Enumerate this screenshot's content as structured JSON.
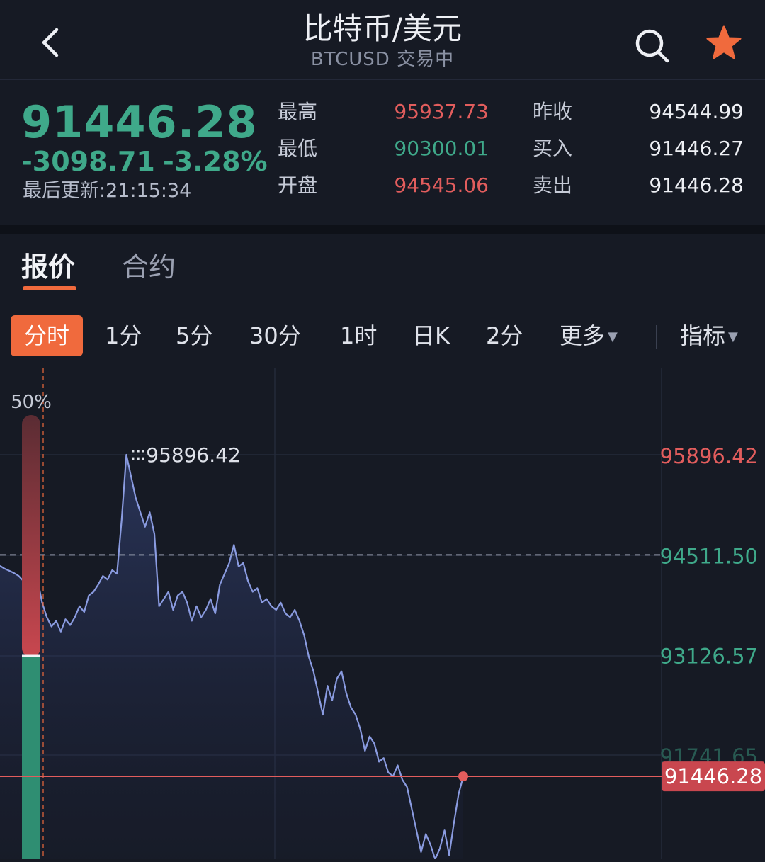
{
  "header": {
    "title": "比特币/美元",
    "subtitle": "BTCUSD 交易中"
  },
  "quote": {
    "price": "91446.28",
    "change": "-3098.71",
    "change_pct": "-3.28%",
    "updated": "最后更新:21:15:34",
    "high_label": "最高",
    "high": "95937.73",
    "low_label": "最低",
    "low": "90300.01",
    "open_label": "开盘",
    "open": "94545.06",
    "prev_close_label": "昨收",
    "prev_close": "94544.99",
    "bid_label": "买入",
    "bid": "91446.27",
    "ask_label": "卖出",
    "ask": "91446.28"
  },
  "tabs": {
    "active": "报价",
    "inactive": "合约"
  },
  "periods": {
    "items": [
      "分时",
      "1分",
      "5分",
      "30分",
      "1时",
      "日K",
      "2分",
      "更多"
    ],
    "indicator": "指标"
  },
  "colors": {
    "accent": "#f06a3d",
    "up": "#e25d5d",
    "down": "#3fa98a",
    "line": "#8a9be0"
  },
  "chart_data": {
    "type": "area",
    "ratio_label": "50%",
    "y_axis_labels": [
      "95896.42",
      "94511.50",
      "93126.57",
      "91741.65"
    ],
    "prev_close_level": 94511.5,
    "current_price": "91446.28",
    "current_value": 91446.28,
    "high_annotation": "95896.42",
    "low_annotation": "90356.73",
    "ylim": [
      89500,
      97000
    ],
    "values": [
      94360,
      94320,
      94290,
      94260,
      94220,
      94150,
      94090,
      94260,
      94180,
      93850,
      93650,
      93520,
      93600,
      93450,
      93620,
      93540,
      93650,
      93800,
      93720,
      93950,
      94000,
      94100,
      94220,
      94170,
      94300,
      94250,
      95000,
      95896,
      95600,
      95300,
      95100,
      94900,
      95100,
      94800,
      93800,
      93900,
      94000,
      93750,
      93950,
      94000,
      93850,
      93600,
      93800,
      93650,
      93750,
      93900,
      93700,
      94100,
      94250,
      94400,
      94650,
      94350,
      94400,
      94150,
      94000,
      94050,
      93850,
      93900,
      93800,
      93750,
      93850,
      93700,
      93650,
      93750,
      93600,
      93400,
      93100,
      92900,
      92600,
      92300,
      92700,
      92500,
      92800,
      92900,
      92600,
      92400,
      92300,
      92100,
      91800,
      92000,
      91900,
      91650,
      91700,
      91500,
      91450,
      91600,
      91400,
      91300,
      91000,
      90700,
      90400,
      90650,
      90500,
      90300,
      90450,
      90700,
      90356,
      90800,
      91200,
      91446
    ]
  }
}
